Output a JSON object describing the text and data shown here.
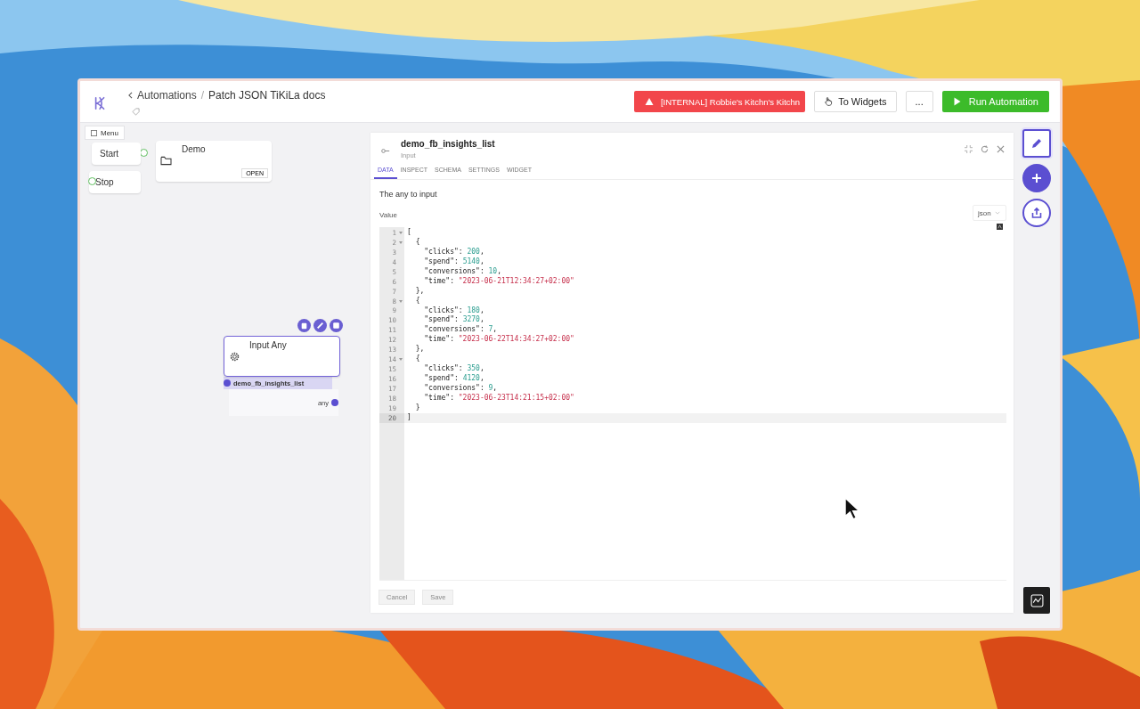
{
  "header": {
    "back": "Automations",
    "separator": "/",
    "current": "Patch JSON TiKiLa docs",
    "buttons": [
      {
        "kind": "warning",
        "label": "[INTERNAL] Robbie's Kitchn's Kitchn"
      },
      {
        "kind": "widgets",
        "label": "To Widgets"
      },
      {
        "kind": "more",
        "label": "..."
      },
      {
        "kind": "run",
        "label": "Run Automation"
      }
    ]
  },
  "canvas": {
    "menu": "Menu",
    "nodes": [
      {
        "kind": "start",
        "label": "Start"
      },
      {
        "kind": "stop",
        "label": "Stop"
      },
      {
        "kind": "folder",
        "label": "Demo",
        "action": "OPEN"
      },
      {
        "kind": "input",
        "label": "Input Any",
        "output_name": "demo_fb_insights_list",
        "output_type": "any",
        "selected": true
      }
    ]
  },
  "panel": {
    "title": "demo_fb_insights_list",
    "subtitle": "Input",
    "tabs": [
      {
        "label": "DATA",
        "selected": true
      },
      {
        "label": "INSPECT",
        "selected": false
      },
      {
        "label": "SCHEMA",
        "selected": false
      },
      {
        "label": "SETTINGS",
        "selected": false
      },
      {
        "label": "WIDGET",
        "selected": false
      }
    ],
    "description": "The any to input",
    "value_label": "Value",
    "format": "json",
    "lines": [
      {
        "number": "1",
        "fold": true,
        "current": false,
        "tokens": [
          {
            "kind": "punct",
            "text": "["
          }
        ]
      },
      {
        "number": "2",
        "fold": true,
        "current": false,
        "tokens": [
          {
            "kind": "punct",
            "text": "  {"
          }
        ]
      },
      {
        "number": "3",
        "fold": false,
        "current": false,
        "tokens": [
          {
            "kind": "key",
            "text": "    \"clicks\": "
          },
          {
            "kind": "number",
            "text": "200"
          },
          {
            "kind": "punct",
            "text": ","
          }
        ]
      },
      {
        "number": "4",
        "fold": false,
        "current": false,
        "tokens": [
          {
            "kind": "key",
            "text": "    \"spend\": "
          },
          {
            "kind": "number",
            "text": "5140"
          },
          {
            "kind": "punct",
            "text": ","
          }
        ]
      },
      {
        "number": "5",
        "fold": false,
        "current": false,
        "tokens": [
          {
            "kind": "key",
            "text": "    \"conversions\": "
          },
          {
            "kind": "number",
            "text": "10"
          },
          {
            "kind": "punct",
            "text": ","
          }
        ]
      },
      {
        "number": "6",
        "fold": false,
        "current": false,
        "tokens": [
          {
            "kind": "key",
            "text": "    \"time\": "
          },
          {
            "kind": "string",
            "text": "\"2023-06-21T12:34:27+02:00\""
          }
        ]
      },
      {
        "number": "7",
        "fold": false,
        "current": false,
        "tokens": [
          {
            "kind": "punct",
            "text": "  },"
          }
        ]
      },
      {
        "number": "8",
        "fold": true,
        "current": false,
        "tokens": [
          {
            "kind": "punct",
            "text": "  {"
          }
        ]
      },
      {
        "number": "9",
        "fold": false,
        "current": false,
        "tokens": [
          {
            "kind": "key",
            "text": "    \"clicks\": "
          },
          {
            "kind": "number",
            "text": "180"
          },
          {
            "kind": "punct",
            "text": ","
          }
        ]
      },
      {
        "number": "10",
        "fold": false,
        "current": false,
        "tokens": [
          {
            "kind": "key",
            "text": "    \"spend\": "
          },
          {
            "kind": "number",
            "text": "3270"
          },
          {
            "kind": "punct",
            "text": ","
          }
        ]
      },
      {
        "number": "11",
        "fold": false,
        "current": false,
        "tokens": [
          {
            "kind": "key",
            "text": "    \"conversions\": "
          },
          {
            "kind": "number",
            "text": "7"
          },
          {
            "kind": "punct",
            "text": ","
          }
        ]
      },
      {
        "number": "12",
        "fold": false,
        "current": false,
        "tokens": [
          {
            "kind": "key",
            "text": "    \"time\": "
          },
          {
            "kind": "string",
            "text": "\"2023-06-22T14:34:27+02:00\""
          }
        ]
      },
      {
        "number": "13",
        "fold": false,
        "current": false,
        "tokens": [
          {
            "kind": "punct",
            "text": "  },"
          }
        ]
      },
      {
        "number": "14",
        "fold": true,
        "current": false,
        "tokens": [
          {
            "kind": "punct",
            "text": "  {"
          }
        ]
      },
      {
        "number": "15",
        "fold": false,
        "current": false,
        "tokens": [
          {
            "kind": "key",
            "text": "    \"clicks\": "
          },
          {
            "kind": "number",
            "text": "350"
          },
          {
            "kind": "punct",
            "text": ","
          }
        ]
      },
      {
        "number": "16",
        "fold": false,
        "current": false,
        "tokens": [
          {
            "kind": "key",
            "text": "    \"spend\": "
          },
          {
            "kind": "number",
            "text": "4120"
          },
          {
            "kind": "punct",
            "text": ","
          }
        ]
      },
      {
        "number": "17",
        "fold": false,
        "current": false,
        "tokens": [
          {
            "kind": "key",
            "text": "    \"conversions\": "
          },
          {
            "kind": "number",
            "text": "9"
          },
          {
            "kind": "punct",
            "text": ","
          }
        ]
      },
      {
        "number": "18",
        "fold": false,
        "current": false,
        "tokens": [
          {
            "kind": "key",
            "text": "    \"time\": "
          },
          {
            "kind": "string",
            "text": "\"2023-06-23T14:21:15+02:00\""
          }
        ]
      },
      {
        "number": "19",
        "fold": false,
        "current": false,
        "tokens": [
          {
            "kind": "punct",
            "text": "  }"
          }
        ]
      },
      {
        "number": "20",
        "fold": false,
        "current": true,
        "tokens": [
          {
            "kind": "punct",
            "text": "]"
          }
        ]
      }
    ],
    "footer": [
      {
        "label": "Cancel",
        "disabled": true
      },
      {
        "label": "Save",
        "disabled": true
      }
    ]
  },
  "rail": [
    {
      "kind": "edit",
      "selected": true
    },
    {
      "kind": "add",
      "selected": false
    },
    {
      "kind": "share",
      "selected": false
    }
  ]
}
